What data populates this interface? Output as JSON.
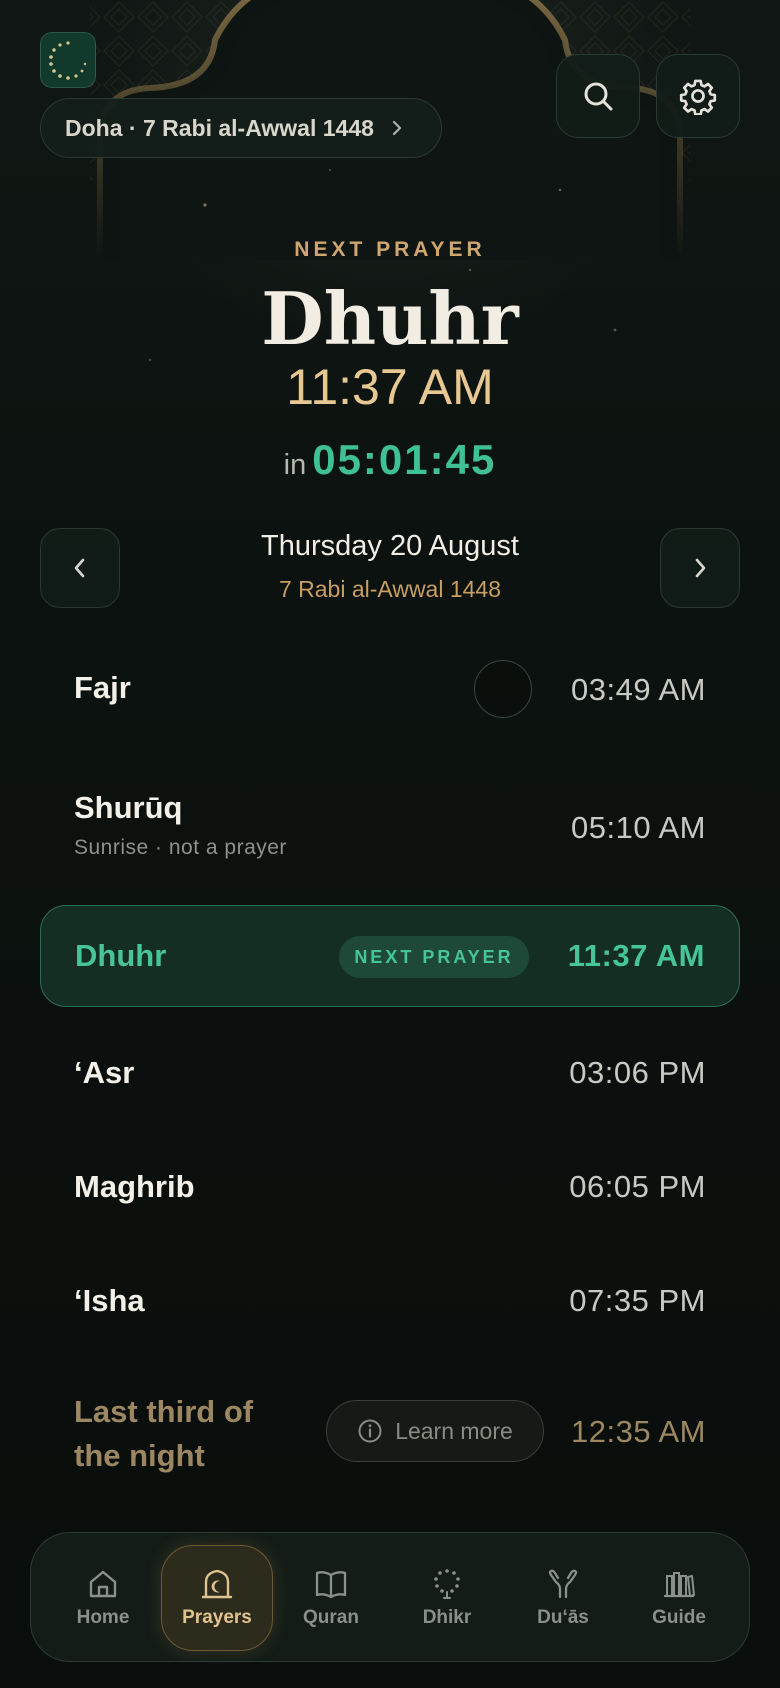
{
  "header": {
    "location": "Doha · 7 Rabi al-Awwal 1448",
    "logo_icon": "crescent-logo-icon",
    "search_icon": "search-icon",
    "settings_icon": "gear-icon"
  },
  "hero": {
    "label": "NEXT PRAYER",
    "prayer_name": "Dhuhr",
    "prayer_time": "11:37 AM",
    "countdown_prefix": "in",
    "countdown": "05:01:45"
  },
  "date_nav": {
    "gregorian": "Thursday 20 August",
    "hijri": "7 Rabi al-Awwal 1448"
  },
  "prayers": [
    {
      "name": "Fajr",
      "time": "03:49 AM"
    },
    {
      "name": "Shurūq",
      "subtitle": "Sunrise · not a prayer",
      "time": "05:10 AM"
    },
    {
      "name": "Dhuhr",
      "badge": "NEXT PRAYER",
      "time": "11:37 AM"
    },
    {
      "name": "‘Asr",
      "time": "03:06 PM"
    },
    {
      "name": "Maghrib",
      "time": "06:05 PM"
    },
    {
      "name": "‘Isha",
      "time": "07:35 PM"
    },
    {
      "name": "Last third of the night",
      "button": "Learn more",
      "time": "12:35 AM"
    }
  ],
  "tabs": [
    {
      "label": "Home",
      "icon": "home-icon"
    },
    {
      "label": "Prayers",
      "icon": "mihrab-icon",
      "selected": true
    },
    {
      "label": "Quran",
      "icon": "book-icon"
    },
    {
      "label": "Dhikr",
      "icon": "prayer-beads-icon"
    },
    {
      "label": "Du‘ās",
      "icon": "raised-hands-icon"
    },
    {
      "label": "Guide",
      "icon": "library-icon"
    }
  ],
  "colors": {
    "background": "#0b100e",
    "accent_green": "#46c597",
    "accent_gold": "#e8c892",
    "active_row": "#142e24"
  }
}
